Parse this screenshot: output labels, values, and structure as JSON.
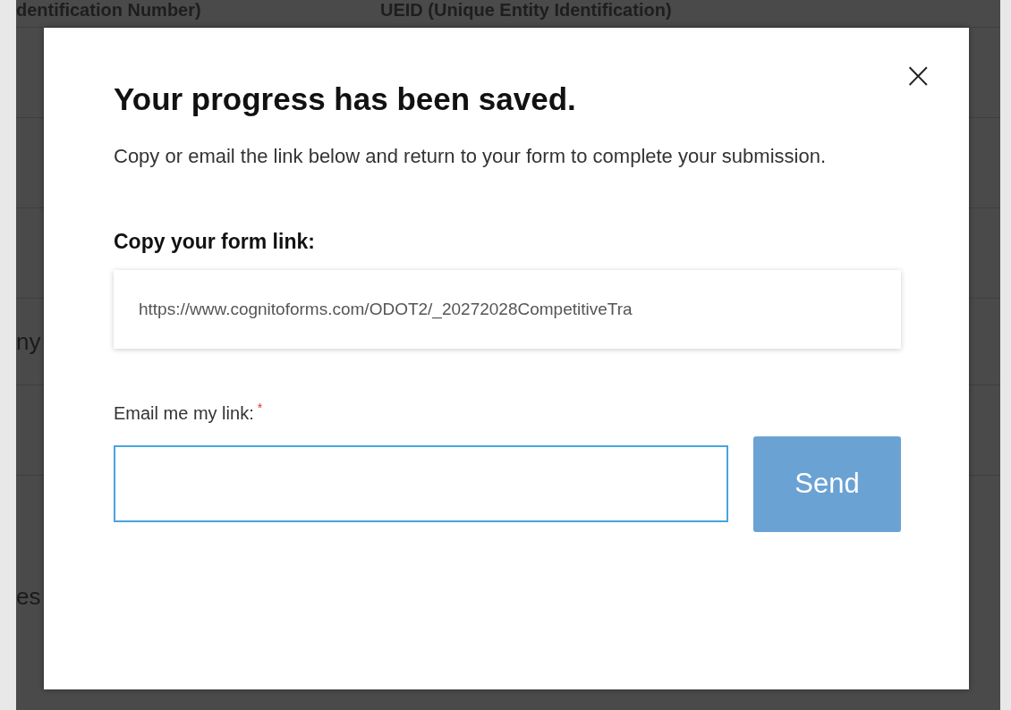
{
  "background": {
    "header": [
      "dentification Number)",
      "UEID (Unique Entity Identification)"
    ],
    "fragments": [
      "ny",
      "es"
    ]
  },
  "dialog": {
    "close": "×",
    "title": "Your progress has been saved.",
    "message": "Copy or email the link below and return to your form to complete your submission.",
    "link_label": "Copy your form link:",
    "link": "https://www.cognitoforms.com/ODOT2/_20272028CompetitiveTra",
    "email_label": "Email me my link:",
    "required_mark": "*",
    "send": "Send"
  }
}
